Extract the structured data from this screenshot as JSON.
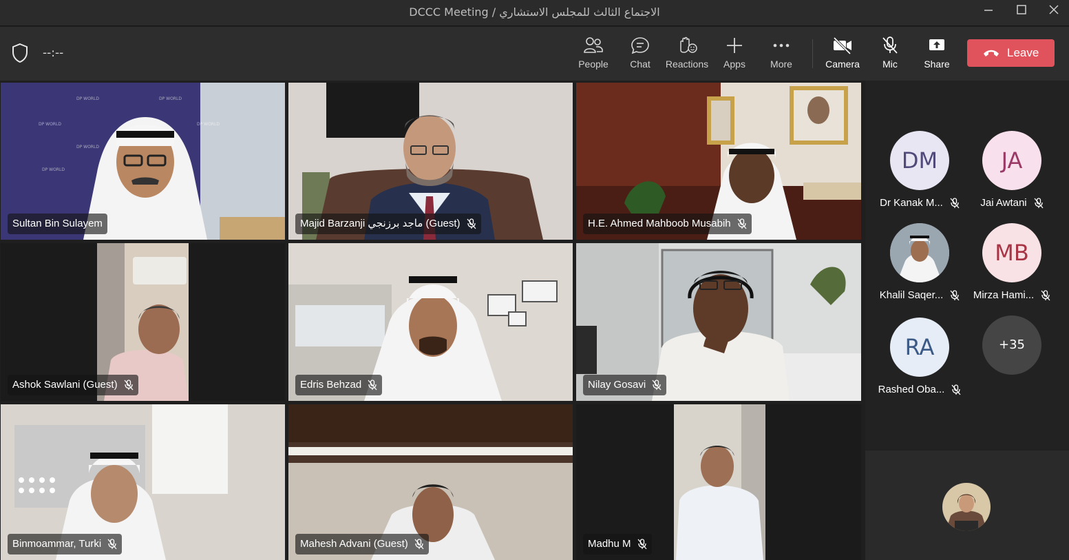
{
  "window": {
    "title": "DCCC Meeting / الاجتماع الثالث للمجلس الاستشاري"
  },
  "toolbar": {
    "timer": "--:--",
    "people": "People",
    "chat": "Chat",
    "reactions": "Reactions",
    "apps": "Apps",
    "more": "More",
    "camera": "Camera",
    "mic": "Mic",
    "share": "Share",
    "leave": "Leave",
    "leave_color": "#e0535c"
  },
  "tiles": [
    {
      "name": "Sultan Bin Sulayem",
      "muted": false,
      "active": true
    },
    {
      "name": "Majid Barzanji ماجد برزنجي (Guest)",
      "muted": true
    },
    {
      "name": "H.E. Ahmed Mahboob Musabih",
      "muted": true
    },
    {
      "name": "Ashok Sawlani (Guest)",
      "muted": true
    },
    {
      "name": "Edris Behzad",
      "muted": true
    },
    {
      "name": "Nilay Gosavi",
      "muted": true
    },
    {
      "name": "Binmoammar, Turki",
      "muted": true
    },
    {
      "name": "Mahesh Advani (Guest)",
      "muted": true
    },
    {
      "name": "Madhu M",
      "muted": true
    }
  ],
  "roster": [
    {
      "initials": "DM",
      "name": "Dr Kanak M...",
      "color": "#e9e6f4",
      "text_color": "#4f4a7a"
    },
    {
      "initials": "JA",
      "name": "Jai Awtani",
      "color": "#f8e1ec",
      "text_color": "#9b3a66"
    },
    {
      "initials": "",
      "name": "Khalil Saqer...",
      "color": "#d8d8d8",
      "text_color": "#333333"
    },
    {
      "initials": "MB",
      "name": "Mirza Hami...",
      "color": "#f8e2e6",
      "text_color": "#a83545"
    },
    {
      "initials": "RA",
      "name": "Rashed Oba...",
      "color": "#e6edf6",
      "text_color": "#3c5a86"
    },
    {
      "initials": "+35",
      "name": "",
      "color": "#454545",
      "text_color": "#ffffff"
    }
  ]
}
